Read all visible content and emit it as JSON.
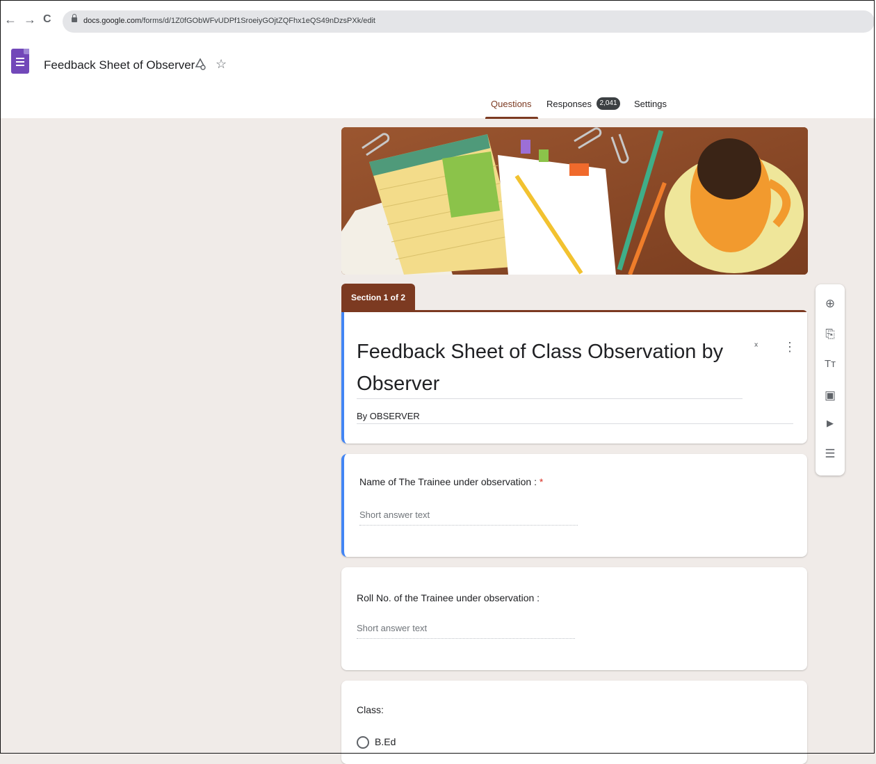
{
  "browser": {
    "back": "←",
    "forward": "→",
    "reload": "C",
    "url_domain": "docs.google.com",
    "url_path": "/forms/d/1Z0fGObWFvUDPf1SroeiyGOjtZQFhx1eQS49nDzsPXk/edit"
  },
  "app": {
    "doc_title": "Feedback Sheet of Observer",
    "icons": {
      "move": "folder-move-icon",
      "star": "star-icon"
    }
  },
  "tabs": {
    "questions": "Questions",
    "responses": "Responses",
    "responses_count": "2,041",
    "settings": "Settings"
  },
  "form": {
    "section_label": "Section 1 of 2",
    "title": "Feedback Sheet of Class Observation by Observer",
    "description": "By OBSERVER",
    "questions": [
      {
        "label": "Name of The Trainee under observation :",
        "required": "*",
        "placeholder": "Short answer text"
      },
      {
        "label": "Roll No. of the Trainee under observation :",
        "placeholder": "Short answer text"
      },
      {
        "label": "Class:",
        "options": [
          "B.Ed"
        ]
      }
    ]
  },
  "sidebar": {
    "add_question": "⊕",
    "import_questions": "⎘",
    "add_title": "Tт",
    "add_image": "▣",
    "add_video": "▶",
    "add_section": "☰"
  },
  "colors": {
    "theme": "#7c3a21",
    "accent": "#4285f4",
    "background": "#f0ebe8"
  }
}
